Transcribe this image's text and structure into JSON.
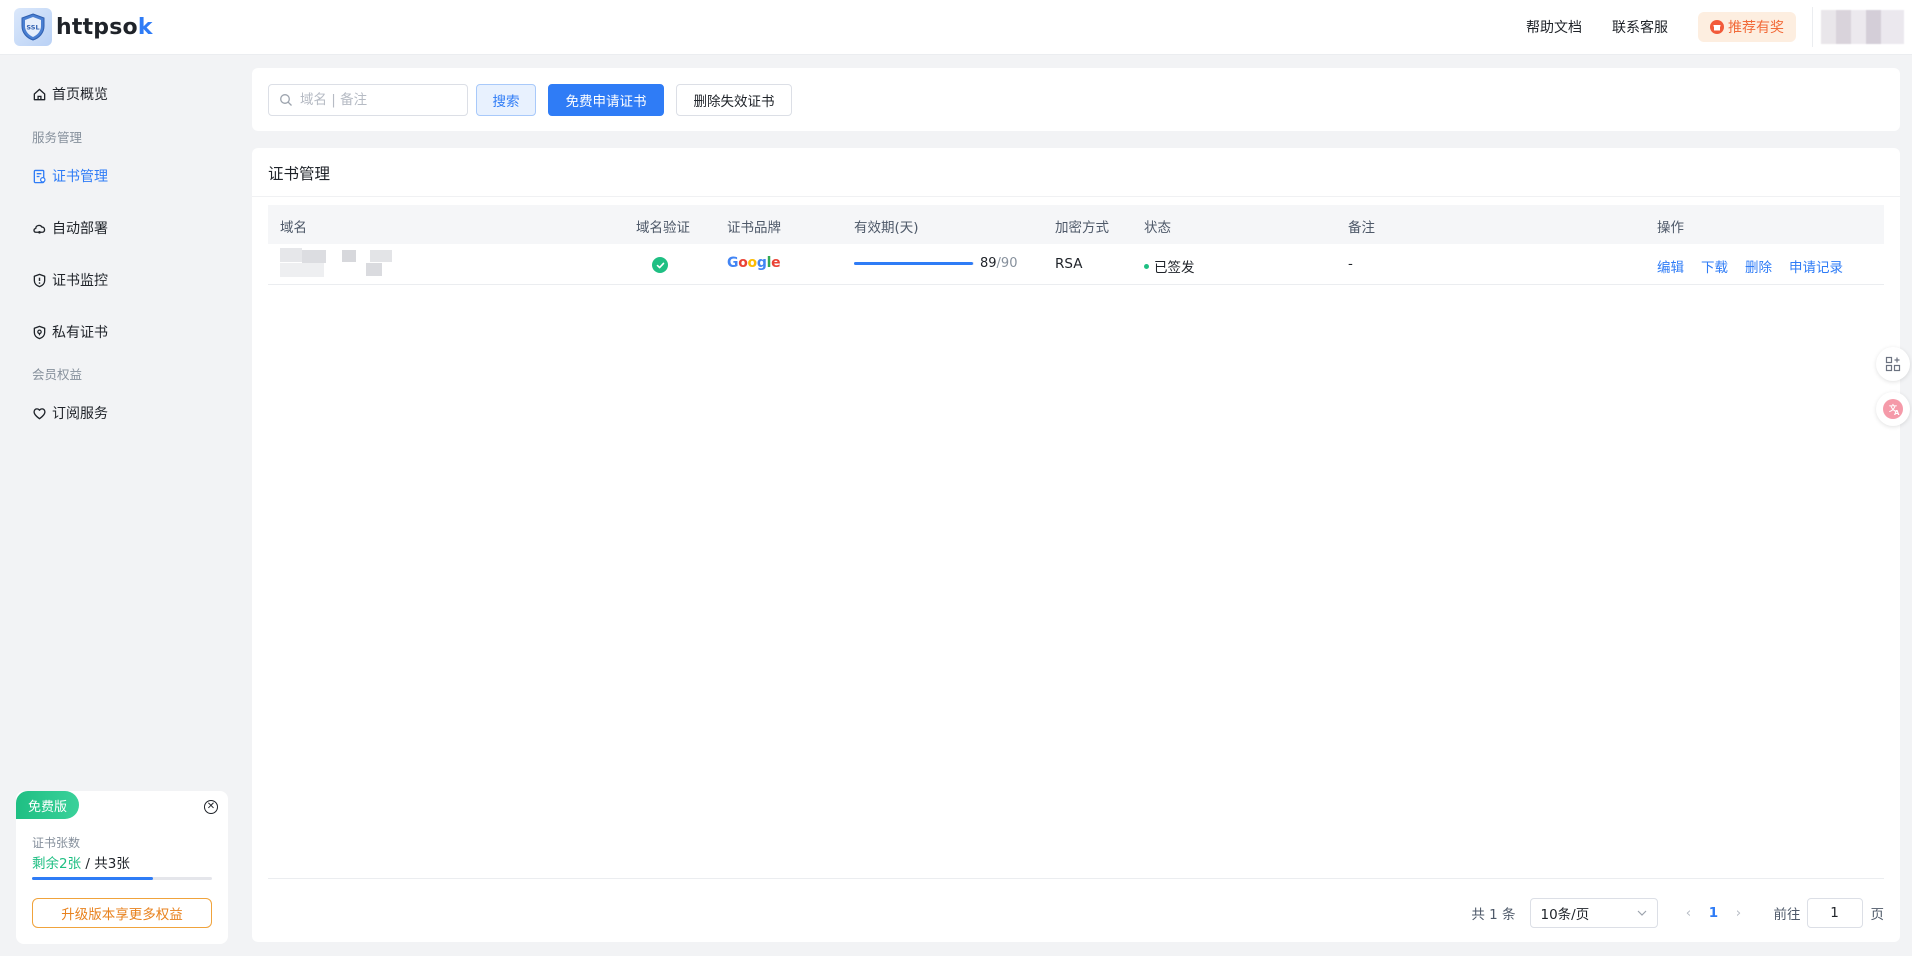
{
  "header": {
    "logo_prefix": "httpso",
    "logo_suffix": "k",
    "logo_badge_text": "SSL",
    "help_docs": "帮助文档",
    "contact": "联系客服",
    "referral": "推荐有奖"
  },
  "sidebar": {
    "home": "首页概览",
    "group_service": "服务管理",
    "cert_manage": "证书管理",
    "auto_deploy": "自动部署",
    "cert_monitor": "证书监控",
    "private_cert": "私有证书",
    "group_member": "会员权益",
    "subscription": "订阅服务"
  },
  "plan": {
    "tag": "免费版",
    "label": "证书张数",
    "remaining": "剩余2张",
    "separator": " / ",
    "total": "共3张",
    "usage_fraction": 0.67,
    "upgrade": "升级版本享更多权益"
  },
  "toolbar": {
    "search_placeholder": "域名 | 备注",
    "search_button": "搜索",
    "apply_button": "免费申请证书",
    "delete_button": "删除失效证书"
  },
  "main": {
    "title": "证书管理",
    "columns": {
      "domain": "域名",
      "verify": "域名验证",
      "brand": "证书品牌",
      "validity": "有效期(天)",
      "encryption": "加密方式",
      "status": "状态",
      "remark": "备注",
      "actions": "操作"
    },
    "rows": [
      {
        "brand": "Google",
        "days_left": "89",
        "days_total": "/90",
        "validity_fraction": 0.989,
        "encryption": "RSA",
        "status": "已签发",
        "remark": "-",
        "edit": "编辑",
        "download": "下载",
        "delete": "删除",
        "history": "申请记录"
      }
    ]
  },
  "pagination": {
    "total": "共 1 条",
    "page_size": "10条/页",
    "current_page": "1",
    "goto_label": "前往",
    "goto_value": "1",
    "page_suffix": "页"
  },
  "colors": {
    "primary": "#2f7cf6",
    "success": "#1fbf83",
    "warning": "#e8821e"
  }
}
